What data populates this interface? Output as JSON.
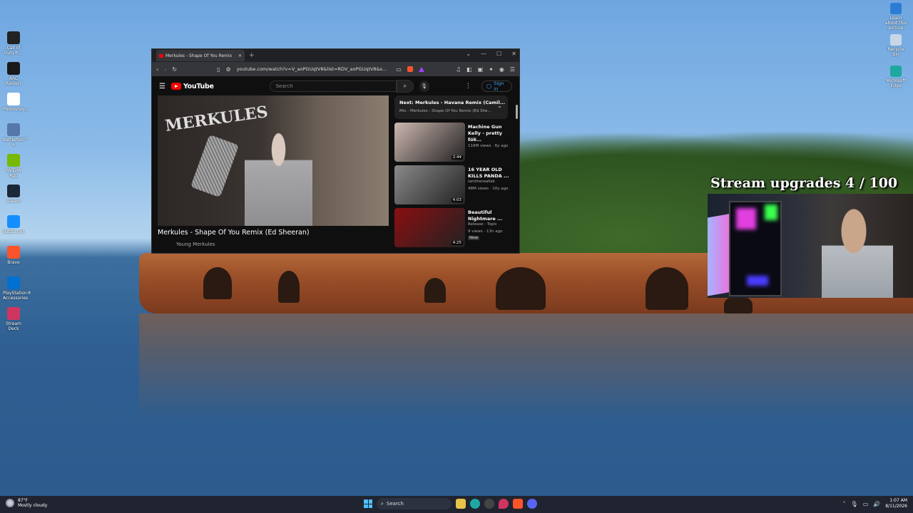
{
  "desktop": {
    "left_icons": [
      {
        "label": "Call of Duty®...",
        "icon": "cod-icon",
        "color": "#222222"
      },
      {
        "label": "ARC Raiders",
        "icon": "arc-raiders-icon",
        "color": "#1a1a1a"
      },
      {
        "label": "Photoshop...",
        "icon": "photoshop-icon",
        "color": "#ffffff"
      },
      {
        "label": "Battlefield™ 6",
        "icon": "battlefield-icon",
        "color": "#5577aa"
      },
      {
        "label": "NVIDIA App",
        "icon": "nvidia-icon",
        "color": "#76b900"
      },
      {
        "label": "Steam",
        "icon": "steam-icon",
        "color": "#1b2838"
      },
      {
        "label": "Battle.net",
        "icon": "battlenet-icon",
        "color": "#148eff"
      },
      {
        "label": "Brave",
        "icon": "brave-icon",
        "color": "#fb542b"
      },
      {
        "label": "PlayStation® Accessories",
        "icon": "playstation-icon",
        "color": "#0070d1"
      },
      {
        "label": "Stream Deck",
        "icon": "streamdeck-icon",
        "color": "#d0355f"
      }
    ],
    "right_icons": [
      {
        "label": "Learn about this picture",
        "icon": "info-icon",
        "color": "#2b7cd3"
      },
      {
        "label": "Recycle Bin",
        "icon": "recycle-bin-icon",
        "color": "#c8d6e5"
      },
      {
        "label": "Microsoft Edge",
        "icon": "edge-icon",
        "color": "#1fa8a0"
      }
    ]
  },
  "browser": {
    "tab_title": "Merkules - Shape Of You Remix",
    "new_tab": "+",
    "window_controls": [
      "⌄",
      "—",
      "☐",
      "✕"
    ],
    "url": "youtube.com/watch?v=V_aoPGUqtV8&list=RDV_aoPGUqtV8&s...",
    "youtube": {
      "logo_text": "YouTube",
      "search_placeholder": "Search",
      "sign_in": "Sign in",
      "video_title": "Merkules - Shape Of You Remix (Ed Sheeran)",
      "channel": "Young Merkules",
      "player_brand": "MERKULES",
      "next_up": {
        "line1": "Next: Merkules - Havana Remix (Camil...",
        "line2": "Mix - Merkules - Shape Of You Remix (Ed She..."
      },
      "recommendations": [
        {
          "title": "Machine Gun Kelly - pretty tox...",
          "channel": "mgk",
          "meta": "118M views · 6y ago",
          "duration": "2:44",
          "color": "#cdb7b0"
        },
        {
          "title": "16 YEAR OLD KILLS PANDA ...",
          "channel": "iamthereallak",
          "meta": "48M views · 10y ago",
          "duration": "4:03",
          "color": "#8a8a8a"
        },
        {
          "title": "Beautiful Nightmare ...",
          "channel": "Release - Topic",
          "meta": "9 views · 11h ago",
          "duration": "4:25",
          "badge": "New",
          "color": "#8a0f12"
        }
      ]
    }
  },
  "stream_overlay": {
    "title": "Stream upgrades 4 / 100",
    "current": 4,
    "goal": 100
  },
  "taskbar": {
    "weather_temp": "87°F",
    "weather_desc": "Mostly cloudy",
    "search_label": "Search",
    "time": "1:07 AM",
    "date": "8/11/2026"
  }
}
